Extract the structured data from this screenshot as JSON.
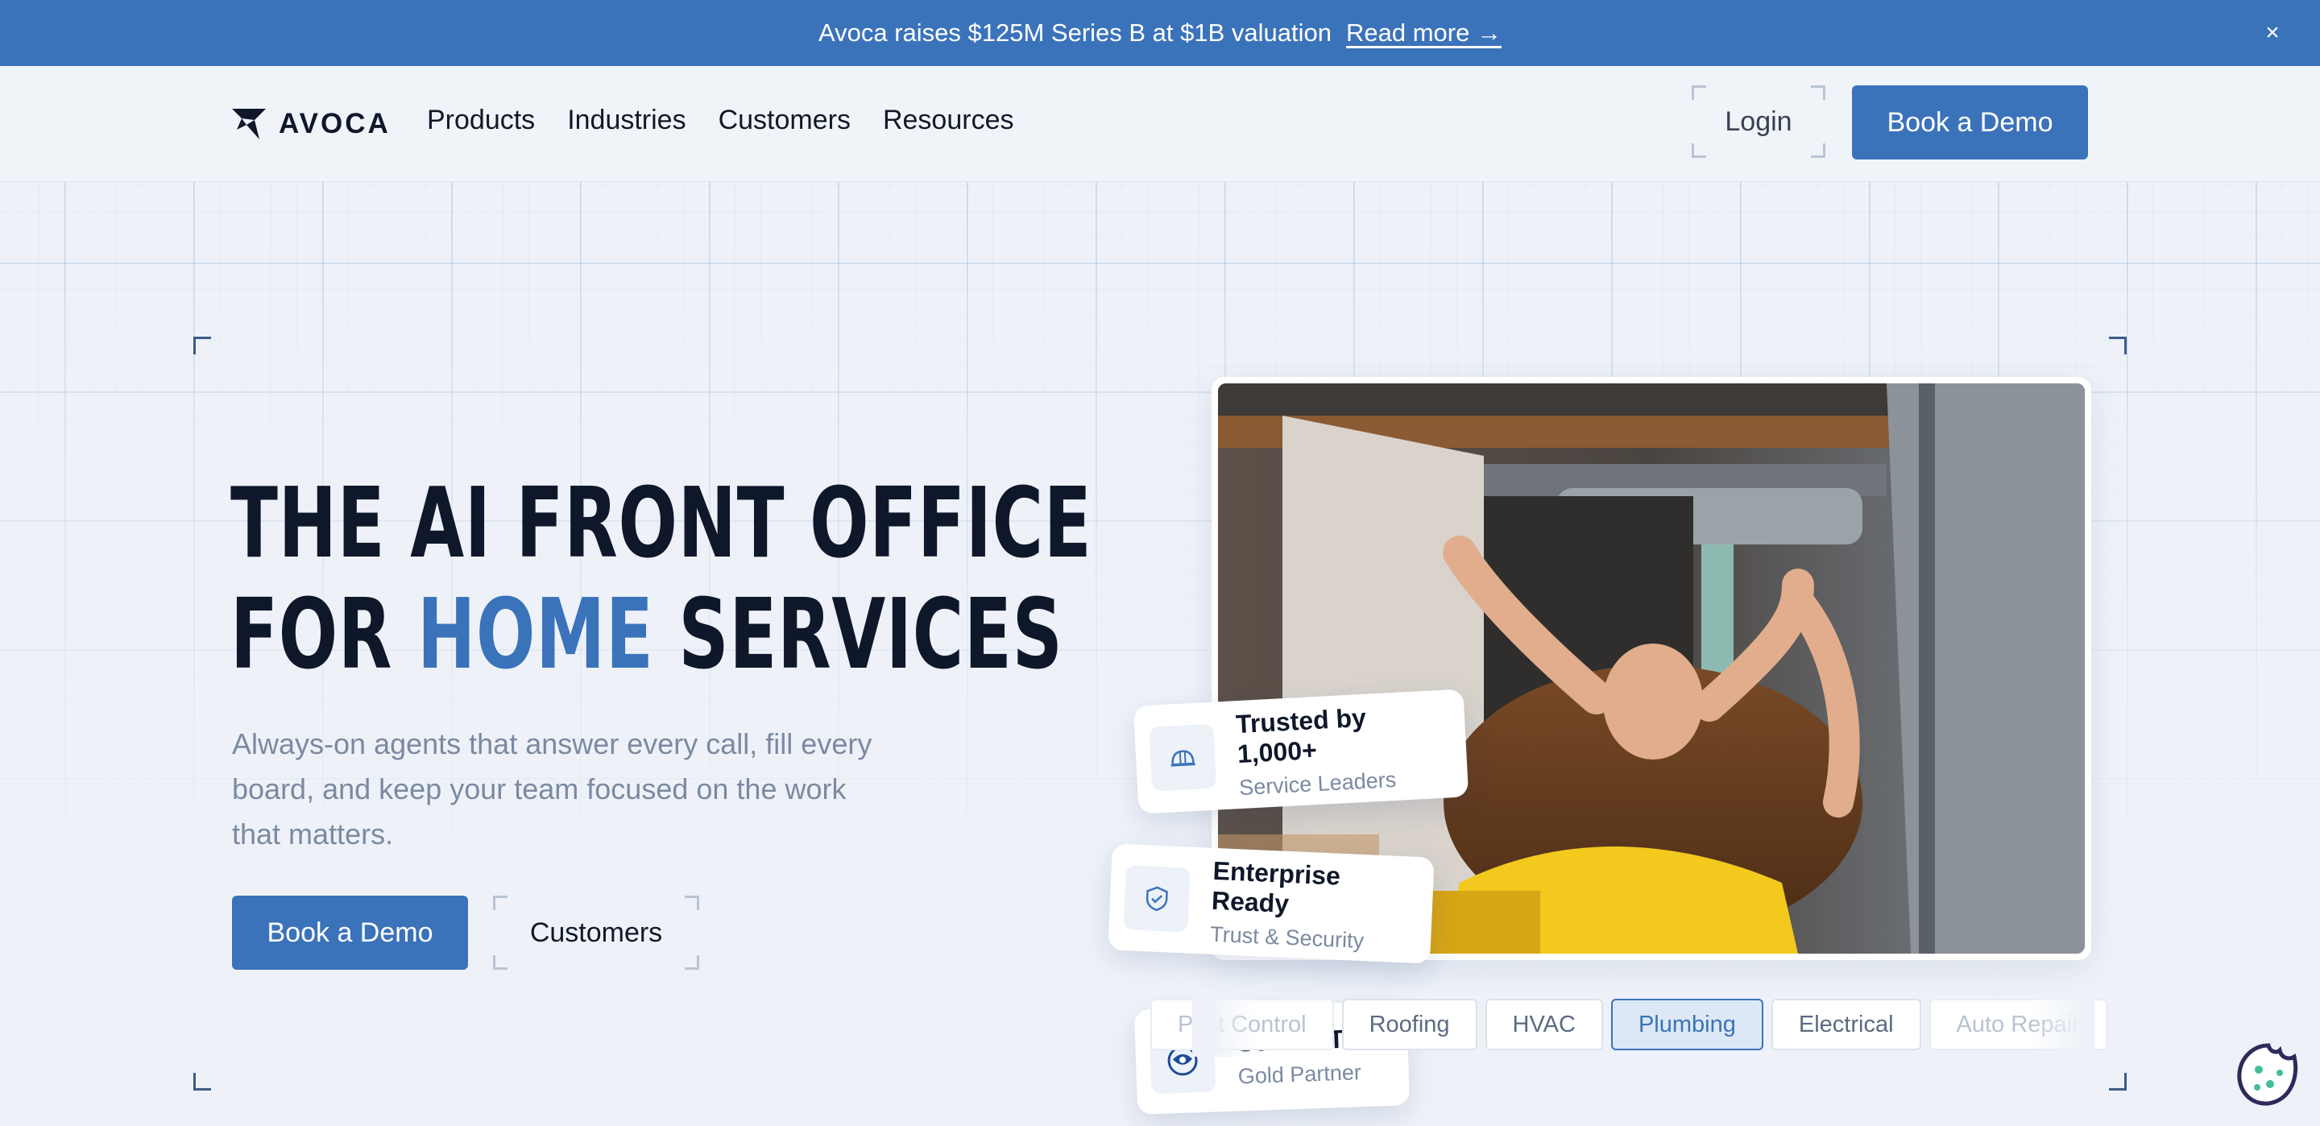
{
  "announcement": {
    "text": "Avoca raises $125M Series B at $1B valuation",
    "link": "Read more →",
    "close_glyph": "×"
  },
  "nav": {
    "logo_text": "AVOCA",
    "links": [
      "Products",
      "Industries",
      "Customers",
      "Resources"
    ],
    "login_label": "Login",
    "demo_label": "Book a Demo"
  },
  "hero": {
    "headline_line1": "THE AI FRONT OFFICE",
    "headline_line2_pre": "FOR ",
    "headline_line2_accent": "HOME",
    "headline_line2_post": " SERVICES",
    "subcopy": "Always-on agents that answer every call, fill every board, and keep your team focused on the work that matters.",
    "primary_cta": "Book a Demo",
    "secondary_cta": "Customers"
  },
  "cards": [
    {
      "title": "Trusted by 1,000+",
      "subtitle": "Service Leaders",
      "icon": "hard-hat-icon"
    },
    {
      "title": "Enterprise Ready",
      "subtitle": "Trust & Security",
      "icon": "shield-check-icon"
    },
    {
      "title": "ServiceTitan",
      "subtitle": "Gold Partner",
      "icon": "servicetitan-logo-icon"
    }
  ],
  "industry_tags": {
    "items": [
      "Pest Control",
      "Roofing",
      "HVAC",
      "Plumbing",
      "Electrical",
      "Auto Repair"
    ],
    "active": "Plumbing"
  },
  "colors": {
    "brand": "#3b73ba",
    "background": "#eef2f8",
    "text_dark": "#0f172a",
    "text_muted": "#7b8aa1"
  }
}
